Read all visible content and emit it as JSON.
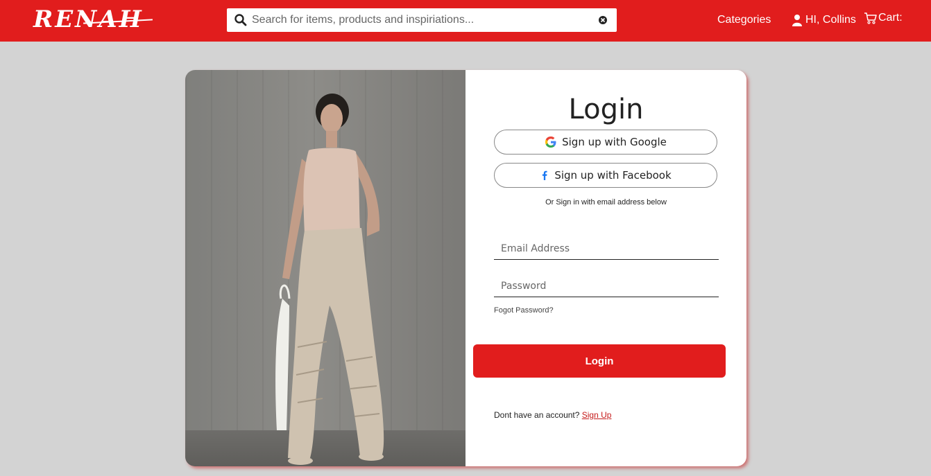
{
  "header": {
    "logo_text": "RENAH",
    "search": {
      "placeholder": "Search for items, products and inspiriations..."
    },
    "nav": {
      "categories": "Categories",
      "greeting": "HI, Collins",
      "cart": "Cart:"
    }
  },
  "login": {
    "title": "Login",
    "google_label": "Sign up with Google",
    "facebook_label": "Sign up with Facebook",
    "or_text": "Or Sign in with email address below",
    "email_placeholder": "Email Address",
    "password_placeholder": "Password",
    "forgot_password": "Fogot Password?",
    "submit_label": "Login",
    "no_account_text": "Dont have an account?",
    "signup_link": "Sign Up"
  },
  "colors": {
    "brand": "#e11d1d",
    "background": "#d3d3d3"
  },
  "icons": [
    "search-icon",
    "clear-icon",
    "user-icon",
    "cart-icon",
    "google-icon",
    "facebook-icon"
  ]
}
